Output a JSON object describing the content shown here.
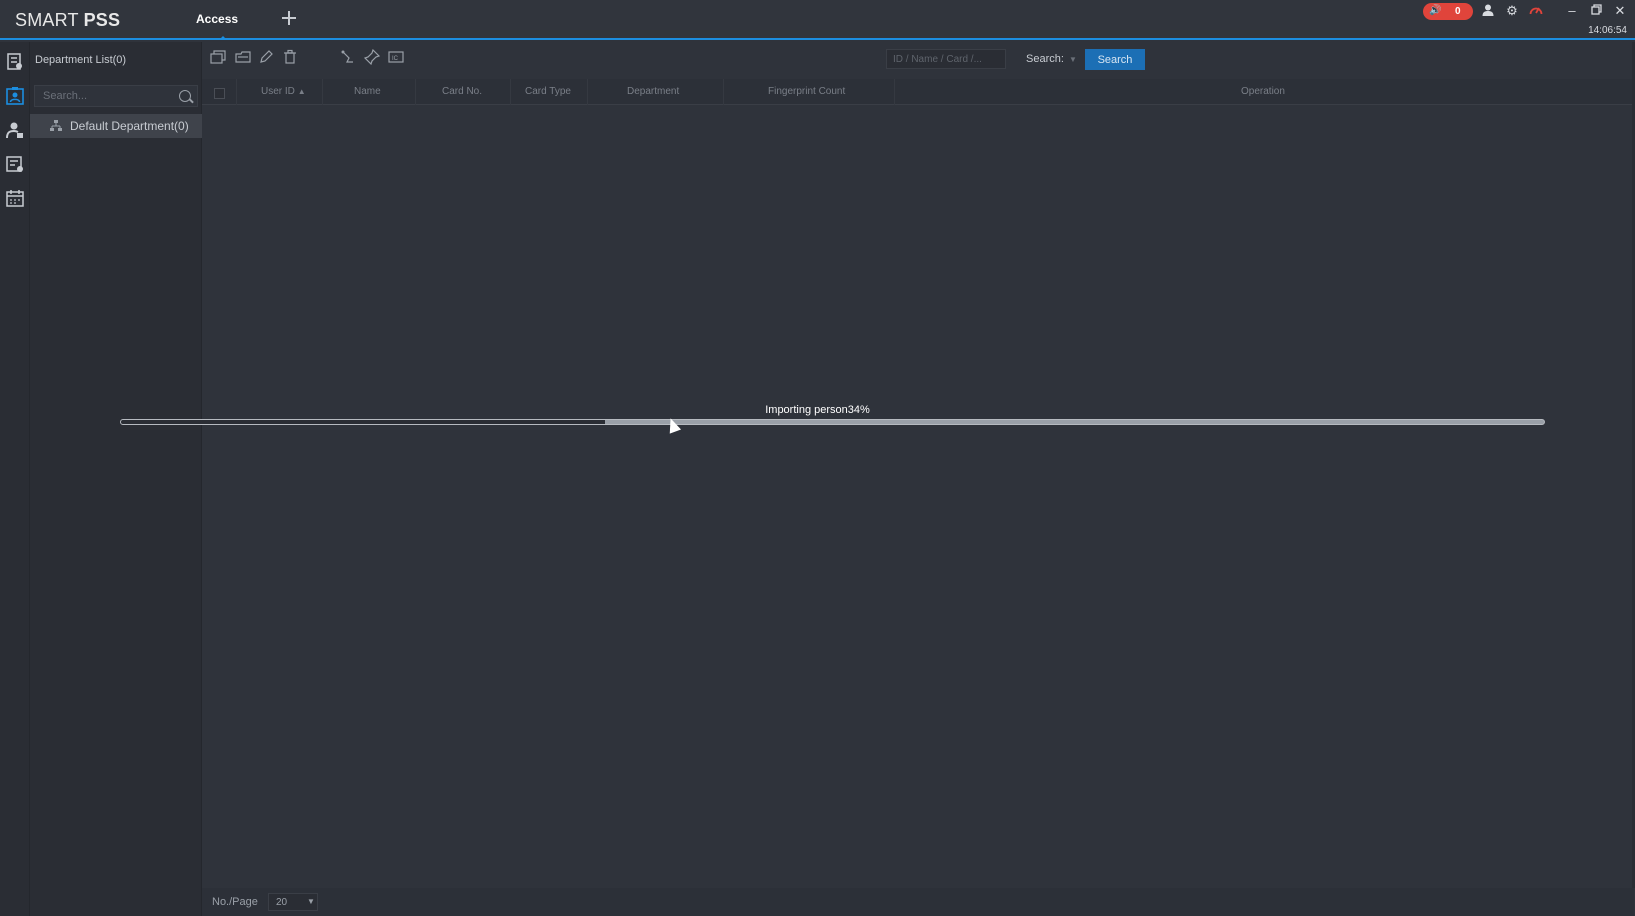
{
  "app": {
    "logo_light": "SMART ",
    "logo_bold": "PSS"
  },
  "tabs": [
    {
      "label": "Access"
    }
  ],
  "topbar": {
    "alarm_count": "0",
    "clock": "14:06:54"
  },
  "left_nav": [
    "personnel-report-icon",
    "person-icon",
    "access-person-icon",
    "records-icon",
    "calendar-icon"
  ],
  "department": {
    "title": "Department List(0)",
    "search_placeholder": "Search...",
    "items": [
      {
        "label": "Default Department(0)"
      }
    ]
  },
  "search": {
    "placeholder": "ID / Name / Card /...",
    "label": "Search:",
    "button": "Search"
  },
  "table": {
    "columns": [
      "User ID",
      "Name",
      "Card No.",
      "Card Type",
      "Department",
      "Fingerprint Count",
      "Operation"
    ]
  },
  "footer": {
    "per_page_label": "No./Page",
    "per_page_value": "20"
  },
  "progress": {
    "label": "Importing person34%",
    "value_percent": 34
  },
  "colors": {
    "accent": "#1c8ee0",
    "alarm": "#e0443b",
    "background": "#2f333b"
  }
}
